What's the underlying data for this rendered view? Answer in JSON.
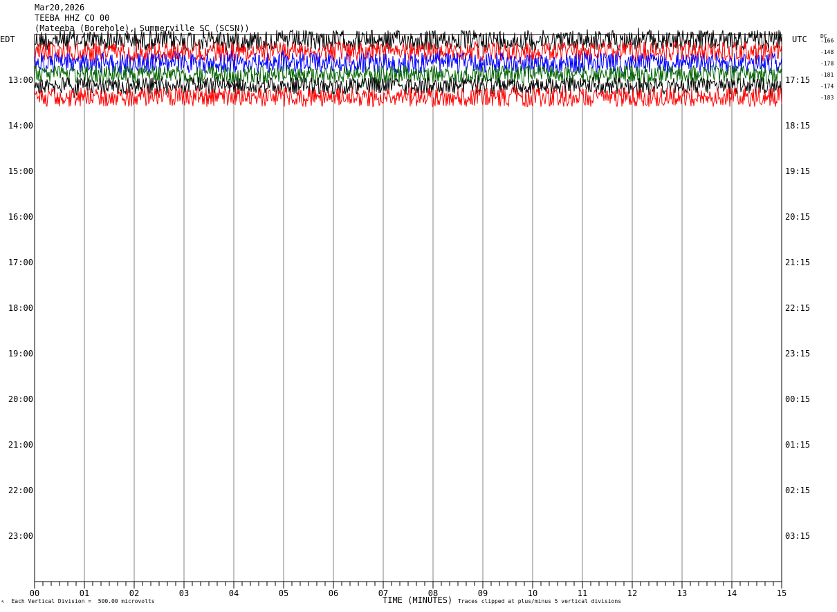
{
  "header": {
    "date": "Mar20,2026",
    "station": "TEEBA HHZ CO 00",
    "location": "(Mateeba (Borehole), Summerville SC (SCSN))"
  },
  "left_axis_title": "EDT",
  "right_axis_title": "UTC",
  "dc_title": "DC",
  "footer": {
    "left": "Each Vertical Division =  500.00 microvolts",
    "corner_mark": "↖",
    "right": "Traces clipped at plus/minus 5 vertical divisions"
  },
  "colors": {
    "black": "#000000",
    "red": "#ff0000",
    "blue": "#0000ff",
    "green": "#006400",
    "grid": "#808080"
  },
  "chart_data": {
    "type": "line",
    "title": "TEEBA HHZ CO 00",
    "xlabel": "TIME (MINUTES)",
    "ylabel": "",
    "xlim": [
      0,
      15
    ],
    "x_ticks": [
      "00",
      "01",
      "02",
      "03",
      "04",
      "05",
      "06",
      "07",
      "08",
      "09",
      "10",
      "11",
      "12",
      "13",
      "14",
      "15"
    ],
    "left_hour_labels": [
      "13:00",
      "14:00",
      "15:00",
      "16:00",
      "17:00",
      "18:00",
      "19:00",
      "20:00",
      "21:00",
      "22:00",
      "23:00"
    ],
    "right_hour_labels": [
      "17:15",
      "18:15",
      "19:15",
      "20:15",
      "21:15",
      "22:15",
      "23:15",
      "00:15",
      "01:15",
      "02:15",
      "03:15"
    ],
    "rows_per_hour": 4,
    "total_rows": 48,
    "grid": true,
    "series": [
      {
        "row": 0,
        "color": "#000000",
        "dc": "-166",
        "amplitude": 0.9
      },
      {
        "row": 1,
        "color": "#ff0000",
        "dc": "-148",
        "amplitude": 0.85
      },
      {
        "row": 2,
        "color": "#0000ff",
        "dc": "-178",
        "amplitude": 0.9
      },
      {
        "row": 3,
        "color": "#006400",
        "dc": "-181",
        "amplitude": 0.8
      },
      {
        "row": 4,
        "color": "#000000",
        "dc": "-174",
        "amplitude": 0.75
      },
      {
        "row": 5,
        "color": "#ff0000",
        "dc": "-183",
        "amplitude": 0.85
      }
    ]
  }
}
